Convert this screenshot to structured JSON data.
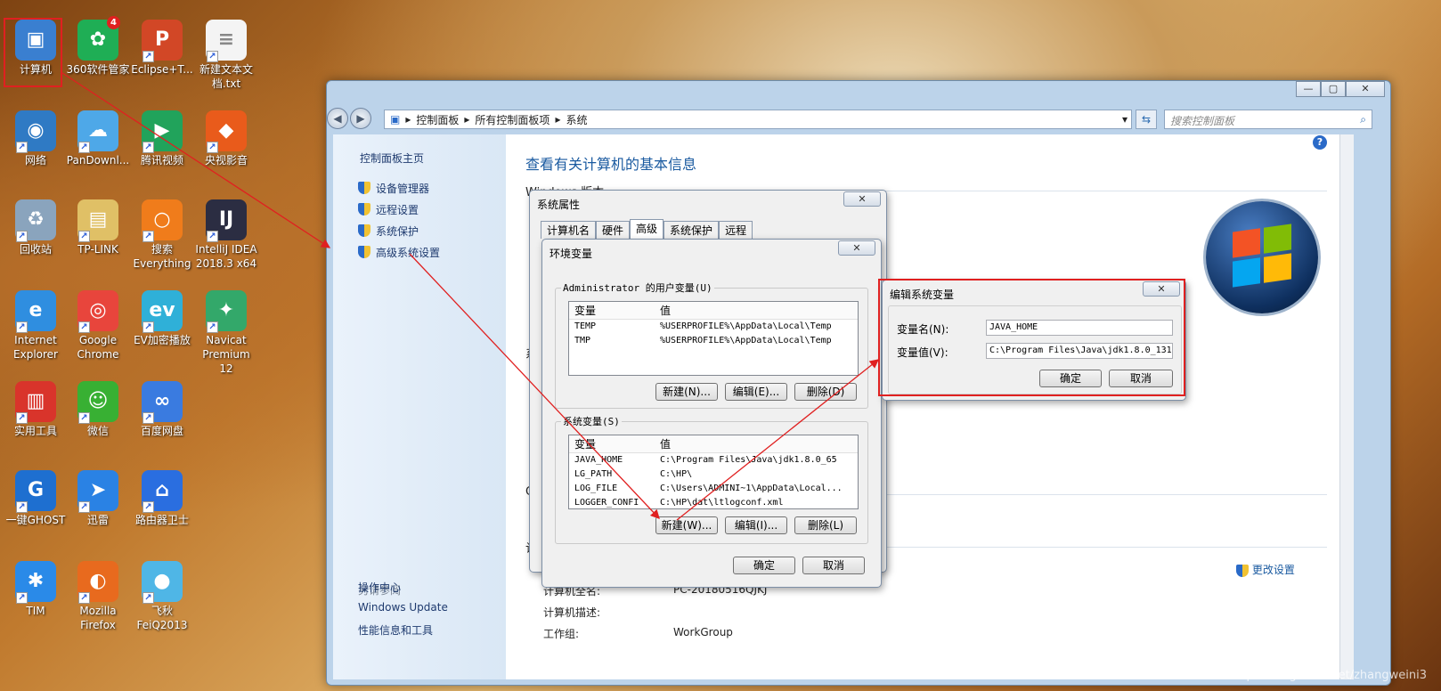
{
  "desktop": {
    "icons": [
      {
        "label": "计算机",
        "glyph": "▣",
        "color": "#3a7fd0"
      },
      {
        "label": "360软件管家",
        "glyph": "✿",
        "color": "#1fae55",
        "badge": "4"
      },
      {
        "label": "Eclipse+T...",
        "glyph": "P",
        "color": "#d24726"
      },
      {
        "label": "新建文本文档.txt",
        "glyph": "≡",
        "color": "#f4f4f4"
      },
      {
        "label": "网络",
        "glyph": "◉",
        "color": "#2f7ac4"
      },
      {
        "label": "PanDownl...",
        "glyph": "☁",
        "color": "#4ea8e8"
      },
      {
        "label": "腾讯视频",
        "glyph": "▶",
        "color": "#21a35b"
      },
      {
        "label": "央视影音",
        "glyph": "◆",
        "color": "#e95b1b"
      },
      {
        "label": "回收站",
        "glyph": "♻",
        "color": "#8aa4bd"
      },
      {
        "label": "TP-LINK",
        "glyph": "▤",
        "color": "#e0c066"
      },
      {
        "label": "搜索 Everything",
        "glyph": "○",
        "color": "#f07c1b"
      },
      {
        "label": "IntelliJ IDEA 2018.3 x64",
        "glyph": "IJ",
        "color": "#2b2d42"
      },
      {
        "label": "Internet Explorer",
        "glyph": "e",
        "color": "#2f8ee0"
      },
      {
        "label": "Google Chrome",
        "glyph": "◎",
        "color": "#e8453c"
      },
      {
        "label": "EV加密播放",
        "glyph": "ev",
        "color": "#2fb0d8"
      },
      {
        "label": "Navicat Premium 12",
        "glyph": "✦",
        "color": "#33a86a"
      },
      {
        "label": "实用工具",
        "glyph": "▥",
        "color": "#d9342b"
      },
      {
        "label": "微信",
        "glyph": "☺",
        "color": "#38b033"
      },
      {
        "label": "百度网盘",
        "glyph": "∞",
        "color": "#3a7be0"
      },
      {
        "label": "一键GHOST",
        "glyph": "G",
        "color": "#1e6fd0"
      },
      {
        "label": "迅雷",
        "glyph": "➤",
        "color": "#2a82e4"
      },
      {
        "label": "路由器卫士",
        "glyph": "⌂",
        "color": "#2a6ee0"
      },
      {
        "label": "TIM",
        "glyph": "✱",
        "color": "#2a8ae8"
      },
      {
        "label": "Mozilla Firefox",
        "glyph": "◐",
        "color": "#e86a1e"
      },
      {
        "label": "飞秋 FeiQ2013",
        "glyph": "●",
        "color": "#4fb6e6"
      }
    ]
  },
  "window": {
    "breadcrumb": [
      "控制面板",
      "所有控制面板项",
      "系统"
    ],
    "search_placeholder": "搜索控制面板",
    "title_buttons": [
      "—",
      "▢",
      "✕"
    ],
    "left_pane": {
      "home": "控制面板主页",
      "links": [
        "设备管理器",
        "远程设置",
        "系统保护",
        "高级系统设置"
      ],
      "see_also": "另请参阅",
      "bottom_links": [
        "操作中心",
        "Windows Update",
        "性能信息和工具"
      ]
    },
    "main": {
      "heading": "查看有关计算机的基本信息",
      "windows_edition": "Windows 版本",
      "section_sys": "系",
      "section_oe": "OE",
      "section_comp": "计",
      "change_settings": "更改设置",
      "rows": [
        {
          "label": "计算机全名:",
          "value": "PC-20180516QJKJ"
        },
        {
          "label": "计算机描述:",
          "value": ""
        },
        {
          "label": "工作组:",
          "value": "WorkGroup"
        }
      ]
    }
  },
  "sysprops": {
    "title": "系统属性",
    "tabs": [
      "计算机名",
      "硬件",
      "高级",
      "系统保护",
      "远程"
    ],
    "active_tab": "高级"
  },
  "envvars": {
    "title": "环境变量",
    "user_group": "Administrator 的用户变量(U)",
    "col_var": "变量",
    "col_val": "值",
    "user_rows": [
      {
        "name": "TEMP",
        "value": "%USERPROFILE%\\AppData\\Local\\Temp"
      },
      {
        "name": "TMP",
        "value": "%USERPROFILE%\\AppData\\Local\\Temp"
      }
    ],
    "user_buttons": [
      "新建(N)...",
      "编辑(E)...",
      "删除(D)"
    ],
    "sys_group": "系统变量(S)",
    "sys_rows": [
      {
        "name": "JAVA_HOME",
        "value": "C:\\Program Files\\Java\\jdk1.8.0_65"
      },
      {
        "name": "LG_PATH",
        "value": "C:\\HP\\"
      },
      {
        "name": "LOG_FILE",
        "value": "C:\\Users\\ADMINI~1\\AppData\\Local..."
      },
      {
        "name": "LOGGER_CONFI",
        "value": "C:\\HP\\dat\\ltlogconf.xml"
      }
    ],
    "sys_buttons": [
      "新建(W)...",
      "编辑(I)...",
      "删除(L)"
    ],
    "ok": "确定",
    "cancel": "取消"
  },
  "editvar": {
    "title": "编辑系统变量",
    "name_label": "变量名(N):",
    "name_value": "JAVA_HOME",
    "value_label": "变量值(V):",
    "value_value": "C:\\Program Files\\Java\\jdk1.8.0_131",
    "ok": "确定",
    "cancel": "取消"
  },
  "watermark": "https://blog.csdn.net/zhangweini3"
}
